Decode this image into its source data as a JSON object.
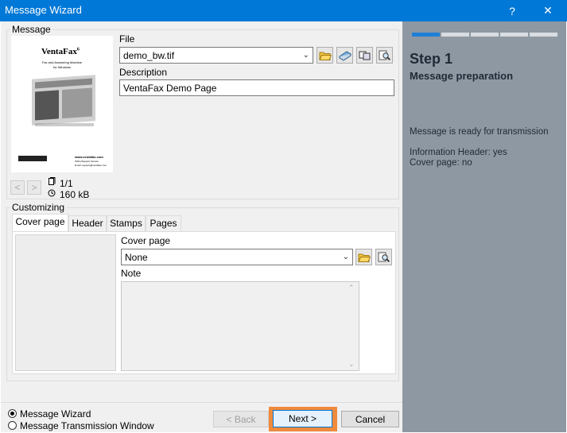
{
  "window": {
    "title": "Message Wizard",
    "help_glyph": "?",
    "close_glyph": "✕"
  },
  "message_group": {
    "legend": "Message",
    "file_label": "File",
    "file_value": "demo_bw.tif",
    "description_label": "Description",
    "description_value": "VentaFax Demo Page",
    "page_counter": "1/1",
    "file_size": "160 kB",
    "prev_glyph": "<",
    "next_glyph": ">"
  },
  "preview": {
    "brand": "VentaFax",
    "brand_version": "6",
    "tagline_1": "Fax and Answering Machine",
    "tagline_2": "for Windows",
    "website": "www.ventafax.com",
    "footer_line_1": "Office/Support Service",
    "footer_line_2": "Email: support@ventafax.com"
  },
  "customizing_group": {
    "legend": "Customizing",
    "tabs": [
      {
        "label": "Cover page"
      },
      {
        "label": "Header"
      },
      {
        "label": "Stamps"
      },
      {
        "label": "Pages"
      }
    ],
    "cover_page_label": "Cover page",
    "cover_page_value": "None",
    "note_label": "Note"
  },
  "bottom": {
    "radio_wizard": "Message Wizard",
    "radio_transmission": "Message Transmission Window",
    "back_label": "< Back",
    "next_label": "Next >",
    "cancel_label": "Cancel"
  },
  "step_panel": {
    "step_title": "Step 1",
    "step_subtitle": "Message preparation",
    "status": "Message is ready for transmission",
    "info_header": "Information Header: yes",
    "cover_page_status": "Cover page: no",
    "progress": {
      "current": 1,
      "total": 5
    }
  },
  "colors": {
    "titlebar": "#0078d7",
    "side_panel": "#8d98a3",
    "highlight": "#f08a3c",
    "progress_active": "#1e7fd6"
  }
}
